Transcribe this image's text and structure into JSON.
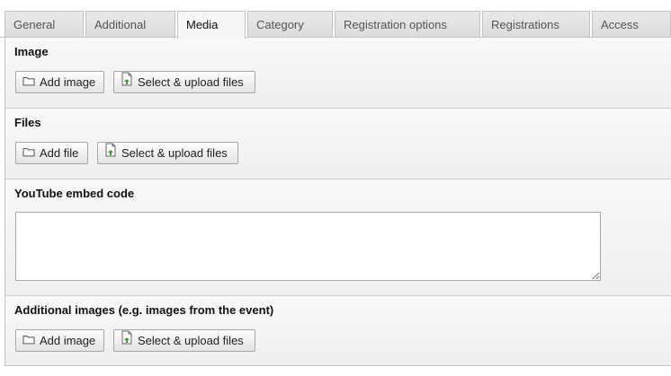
{
  "tabs": [
    {
      "label": "General",
      "active": false
    },
    {
      "label": "Additional",
      "active": false
    },
    {
      "label": "Media",
      "active": true
    },
    {
      "label": "Category",
      "active": false
    },
    {
      "label": "Registration options",
      "active": false
    },
    {
      "label": "Registrations",
      "active": false
    },
    {
      "label": "Access",
      "active": false
    }
  ],
  "sections": {
    "image": {
      "title": "Image",
      "add_label": "Add image",
      "add_icon": "folder-icon",
      "upload_label": "Select & upload files",
      "upload_icon": "file-upload-icon"
    },
    "files": {
      "title": "Files",
      "add_label": "Add file",
      "add_icon": "folder-icon",
      "upload_label": "Select & upload files",
      "upload_icon": "file-upload-icon"
    },
    "youtube": {
      "title": "YouTube embed code",
      "value": ""
    },
    "additional_images": {
      "title": "Additional images (e.g. images from the event)",
      "add_label": "Add image",
      "add_icon": "folder-icon",
      "upload_label": "Select & upload files",
      "upload_icon": "file-upload-icon"
    }
  },
  "colors": {
    "panel_bg": "#f6f6f6",
    "border": "#c3c3c3",
    "upload_icon_accent": "#3c9a3c"
  }
}
